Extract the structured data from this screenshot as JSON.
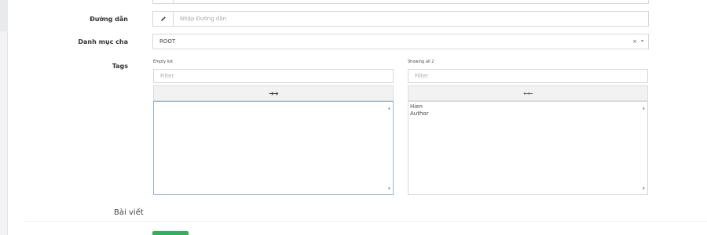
{
  "form": {
    "path": {
      "label": "Đường dẫn",
      "placeholder": "Nhập Đường dẫn",
      "value": "",
      "icon": "pencil-icon"
    },
    "parent_category": {
      "label": "Danh mục cha",
      "value": "ROOT",
      "clear_glyph": "×",
      "caret_glyph": "▾"
    },
    "tags": {
      "label": "Tags",
      "available": {
        "info": "Empty list",
        "filter_placeholder": "Filter",
        "move_glyph": "➔➔",
        "items": []
      },
      "selected": {
        "info": "Showing all 2",
        "filter_placeholder": "Filter",
        "move_glyph": "⇽⇽",
        "items": [
          "Hien",
          "Author"
        ]
      }
    }
  },
  "section": {
    "title": "Bài viết"
  },
  "colors": {
    "primary_button": "#2fb35a",
    "focused_border": "#8fb5d9"
  }
}
